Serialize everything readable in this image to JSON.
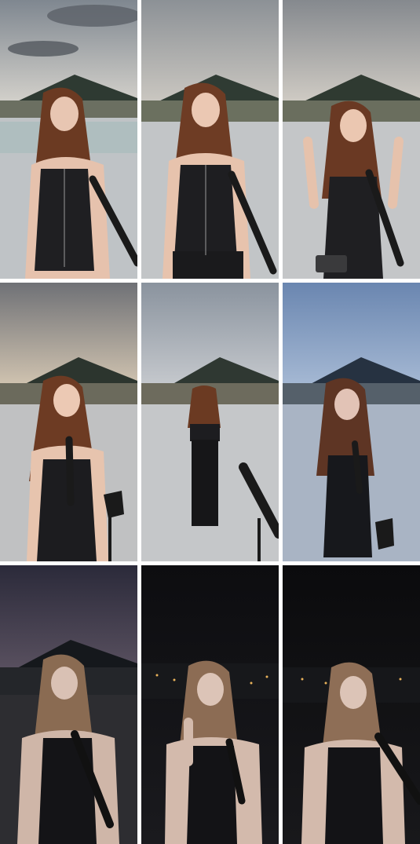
{
  "collage": {
    "rows": 3,
    "cols": 3,
    "frames": [
      {
        "time": "day-overcast",
        "pose": "looking-down",
        "sky_top": "#7f8790",
        "sky_bottom": "#d9d6cf"
      },
      {
        "time": "day-overcast",
        "pose": "smiling-forward",
        "sky_top": "#8c9196",
        "sky_bottom": "#cfcbc4"
      },
      {
        "time": "day-overcast",
        "pose": "hands-raised",
        "sky_top": "#85898e",
        "sky_bottom": "#d5d0c8"
      },
      {
        "time": "dusk",
        "pose": "singing-with-mic",
        "sky_top": "#6f7176",
        "sky_bottom": "#d7c9b4"
      },
      {
        "time": "dusk",
        "pose": "walking-away",
        "sky_top": "#8a939e",
        "sky_bottom": "#c9ccd0"
      },
      {
        "time": "blue-hour",
        "pose": "singing-with-mic",
        "sky_top": "#6a86b0",
        "sky_bottom": "#a9bcd6"
      },
      {
        "time": "evening",
        "pose": "singing-eyes-closed",
        "sky_top": "#2b2a3a",
        "sky_bottom": "#5b5261"
      },
      {
        "time": "night",
        "pose": "hand-gesture",
        "sky_top": "#0d0d10",
        "sky_bottom": "#1a1a1e"
      },
      {
        "time": "night",
        "pose": "touching-ear",
        "sky_top": "#0b0b0d",
        "sky_bottom": "#18181b"
      }
    ]
  }
}
